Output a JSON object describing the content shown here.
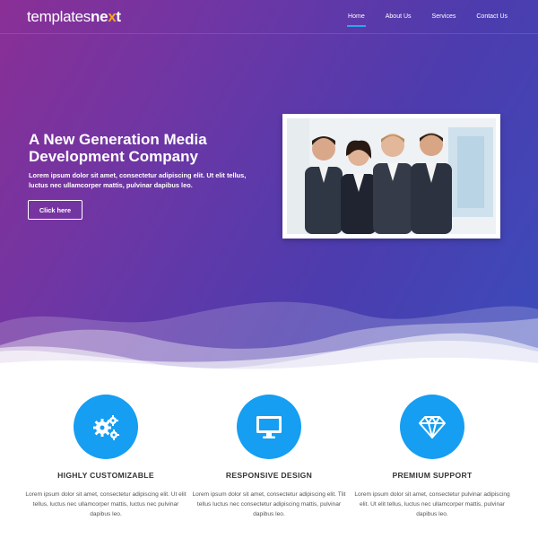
{
  "brand": {
    "logo_light": "templates",
    "logo_bold": "ne",
    "logo_accent": "x",
    "logo_end": "t"
  },
  "nav": {
    "items": [
      {
        "label": "Home",
        "active": true
      },
      {
        "label": "About Us",
        "active": false
      },
      {
        "label": "Services",
        "active": false
      },
      {
        "label": "Contact Us",
        "active": false
      }
    ]
  },
  "hero": {
    "title": "A New Generation Media Development Company",
    "text": "Lorem ipsum dolor sit amet, consectetur adipiscing elit. Ut elit tellus, luctus nec ullamcorper mattis, pulvinar dapibus leo.",
    "button_label": "Click here"
  },
  "features": [
    {
      "icon": "gears-icon",
      "title": "HIGHLY CUSTOMIZABLE",
      "text": "Lorem ipsum dolor sit amet, consectetur adipiscing elit. Ut elit tellus, luctus nec ullamcorper mattis, luctus nec pulvinar dapibus leo."
    },
    {
      "icon": "monitor-icon",
      "title": "RESPONSIVE DESIGN",
      "text": "Lorem ipsum dolor sit amet, consectetur adipiscing elit. Tlit tellus luctus nec consectetur adipiscing mattis, pulvinar dapibus leo."
    },
    {
      "icon": "diamond-icon",
      "title": "PREMIUM SUPPORT",
      "text": "Lorem ipsum dolor sit amet, consectetur pulvinar adipiscing elit. Ut elit tellus, luctus nec ullamcorper mattis, pulvinar dapibus leo."
    }
  ],
  "colors": {
    "hero_gradient_start": "#8a2f96",
    "hero_gradient_end": "#3b4cbb",
    "accent_blue": "#159ef2",
    "nav_active_underline": "#2aa8e8",
    "logo_accent": "#f5a524"
  }
}
